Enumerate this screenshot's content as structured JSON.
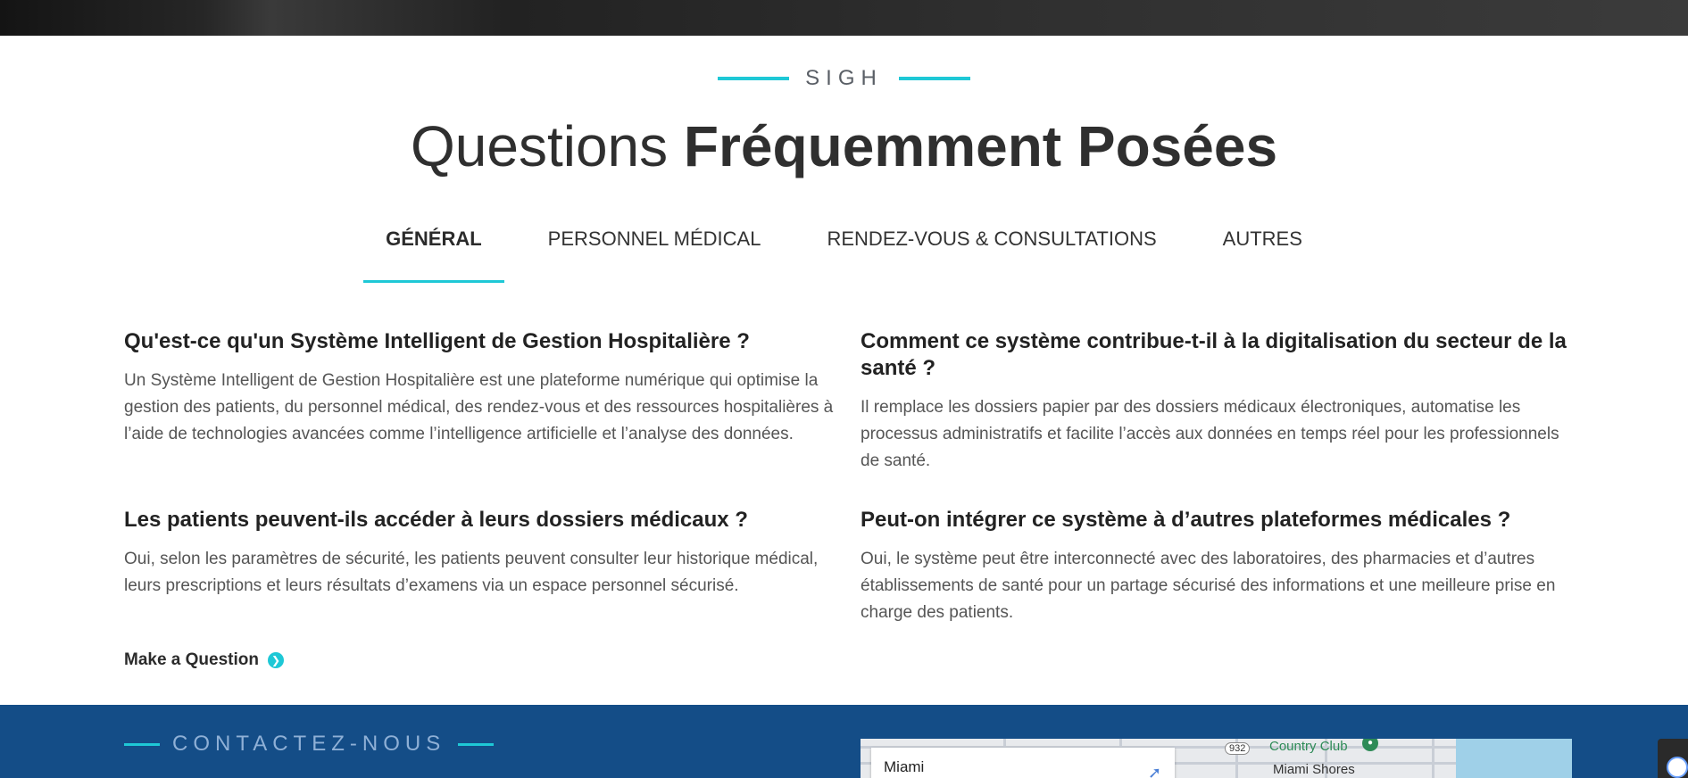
{
  "eyebrow": "SIGH",
  "title": {
    "light": "Questions",
    "bold": "Fréquemment Posées"
  },
  "tabs": [
    {
      "label": "GÉNÉRAL",
      "active": true
    },
    {
      "label": "PERSONNEL MÉDICAL",
      "active": false
    },
    {
      "label": "RENDEZ-VOUS & CONSULTATIONS",
      "active": false
    },
    {
      "label": "AUTRES",
      "active": false
    }
  ],
  "faq": [
    {
      "question": "Qu'est-ce qu'un Système Intelligent de Gestion Hospitalière ?",
      "answer": "Un Système Intelligent de Gestion Hospitalière est une plateforme numérique qui optimise la gestion des patients, du personnel médical, des rendez-vous et des ressources hospitalières à l’aide de technologies avancées comme l’intelligence artificielle et l’analyse des données."
    },
    {
      "question": "Comment ce système contribue-t-il à la digitalisation du secteur de la santé ?",
      "answer": "Il remplace les dossiers papier par des dossiers médicaux électroniques, automatise les processus administratifs et facilite l’accès aux données en temps réel pour les professionnels de santé."
    },
    {
      "question": "Les patients peuvent-ils accéder à leurs dossiers médicaux ?",
      "answer": "Oui, selon les paramètres de sécurité, les patients peuvent consulter leur historique médical, leurs prescriptions et leurs résultats d’examens via un espace personnel sécurisé."
    },
    {
      "question": "Peut-on intégrer ce système à d’autres plateformes médicales ?",
      "answer": "Oui, le système peut être interconnecté avec des laboratoires, des pharmacies et d’autres établissements de santé pour un partage sécurisé des informations et une meilleure prise en charge des patients."
    }
  ],
  "make_question": "Make a Question",
  "contact": {
    "eyebrow": "CONTACTEZ-NOUS"
  },
  "map": {
    "city": "Miami",
    "labels": {
      "country_club": "Country Club",
      "miami_shores": "Miami Shores",
      "route": "932"
    }
  },
  "colors": {
    "accent": "#1ec8d6",
    "contact_bg": "#144d87"
  }
}
